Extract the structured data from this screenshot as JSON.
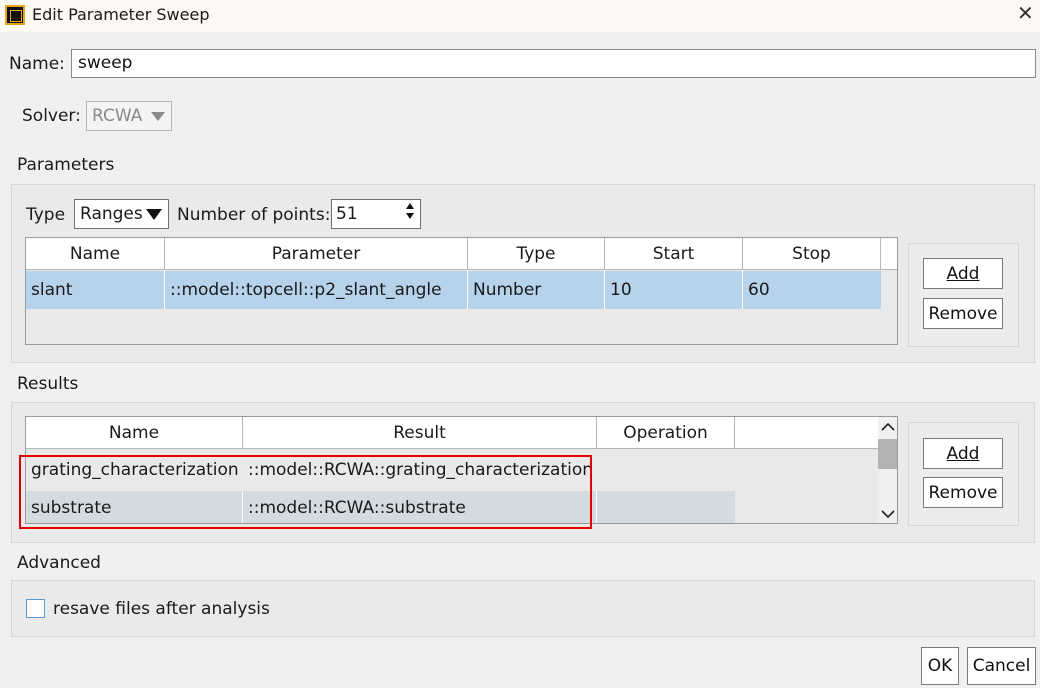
{
  "window": {
    "title": "Edit Parameter Sweep"
  },
  "name_field": {
    "label": "Name:",
    "value": "sweep"
  },
  "solver": {
    "label": "Solver:",
    "value": "RCWA"
  },
  "parameters": {
    "section_title": "Parameters",
    "type_label": "Type",
    "type_value": "Ranges",
    "points_label": "Number of points:",
    "points_value": "51",
    "columns": [
      "Name",
      "Parameter",
      "Type",
      "Start",
      "Stop"
    ],
    "rows": [
      {
        "name": "slant",
        "parameter": "::model::topcell::p2_slant_angle",
        "type": "Number",
        "start": "10",
        "stop": "60"
      }
    ],
    "add_label": "Add",
    "remove_label": "Remove"
  },
  "results": {
    "section_title": "Results",
    "columns": [
      "Name",
      "Result",
      "Operation"
    ],
    "rows": [
      {
        "name": "grating_characterization",
        "result": "::model::RCWA::grating_characterization",
        "operation": ""
      },
      {
        "name": "substrate",
        "result": "::model::RCWA::substrate",
        "operation": ""
      }
    ],
    "add_label": "Add",
    "remove_label": "Remove"
  },
  "advanced": {
    "section_title": "Advanced",
    "resave_label": "resave files after analysis",
    "resave_checked": false
  },
  "footer": {
    "ok_label": "OK",
    "cancel_label": "Cancel"
  },
  "colors": {
    "selected_row": "#b7d3ec",
    "highlight_border": "#e00000",
    "row_alt": "#d3dbe1"
  }
}
